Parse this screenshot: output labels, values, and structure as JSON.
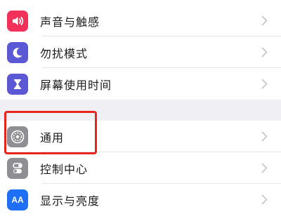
{
  "settings": {
    "group1": [
      {
        "label": "声音与触感",
        "icon": "speaker-icon",
        "color": "#f2315a"
      },
      {
        "label": "勿扰模式",
        "icon": "moon-icon",
        "color": "#5b58d6"
      },
      {
        "label": "屏幕使用时间",
        "icon": "hourglass-icon",
        "color": "#5b58d6"
      }
    ],
    "group2": [
      {
        "label": "通用",
        "icon": "gear-icon",
        "color": "#8e8e93"
      },
      {
        "label": "控制中心",
        "icon": "toggle-switches-icon",
        "color": "#8e8e93"
      },
      {
        "label": "显示与亮度",
        "icon": "text-size-icon",
        "color": "#1e6ff5",
        "icon_text": "AA"
      }
    ]
  },
  "annotation": {
    "color": "#e8241e"
  },
  "colors": {
    "separator": "#efeff4",
    "chevron": "#c7c7cc"
  }
}
